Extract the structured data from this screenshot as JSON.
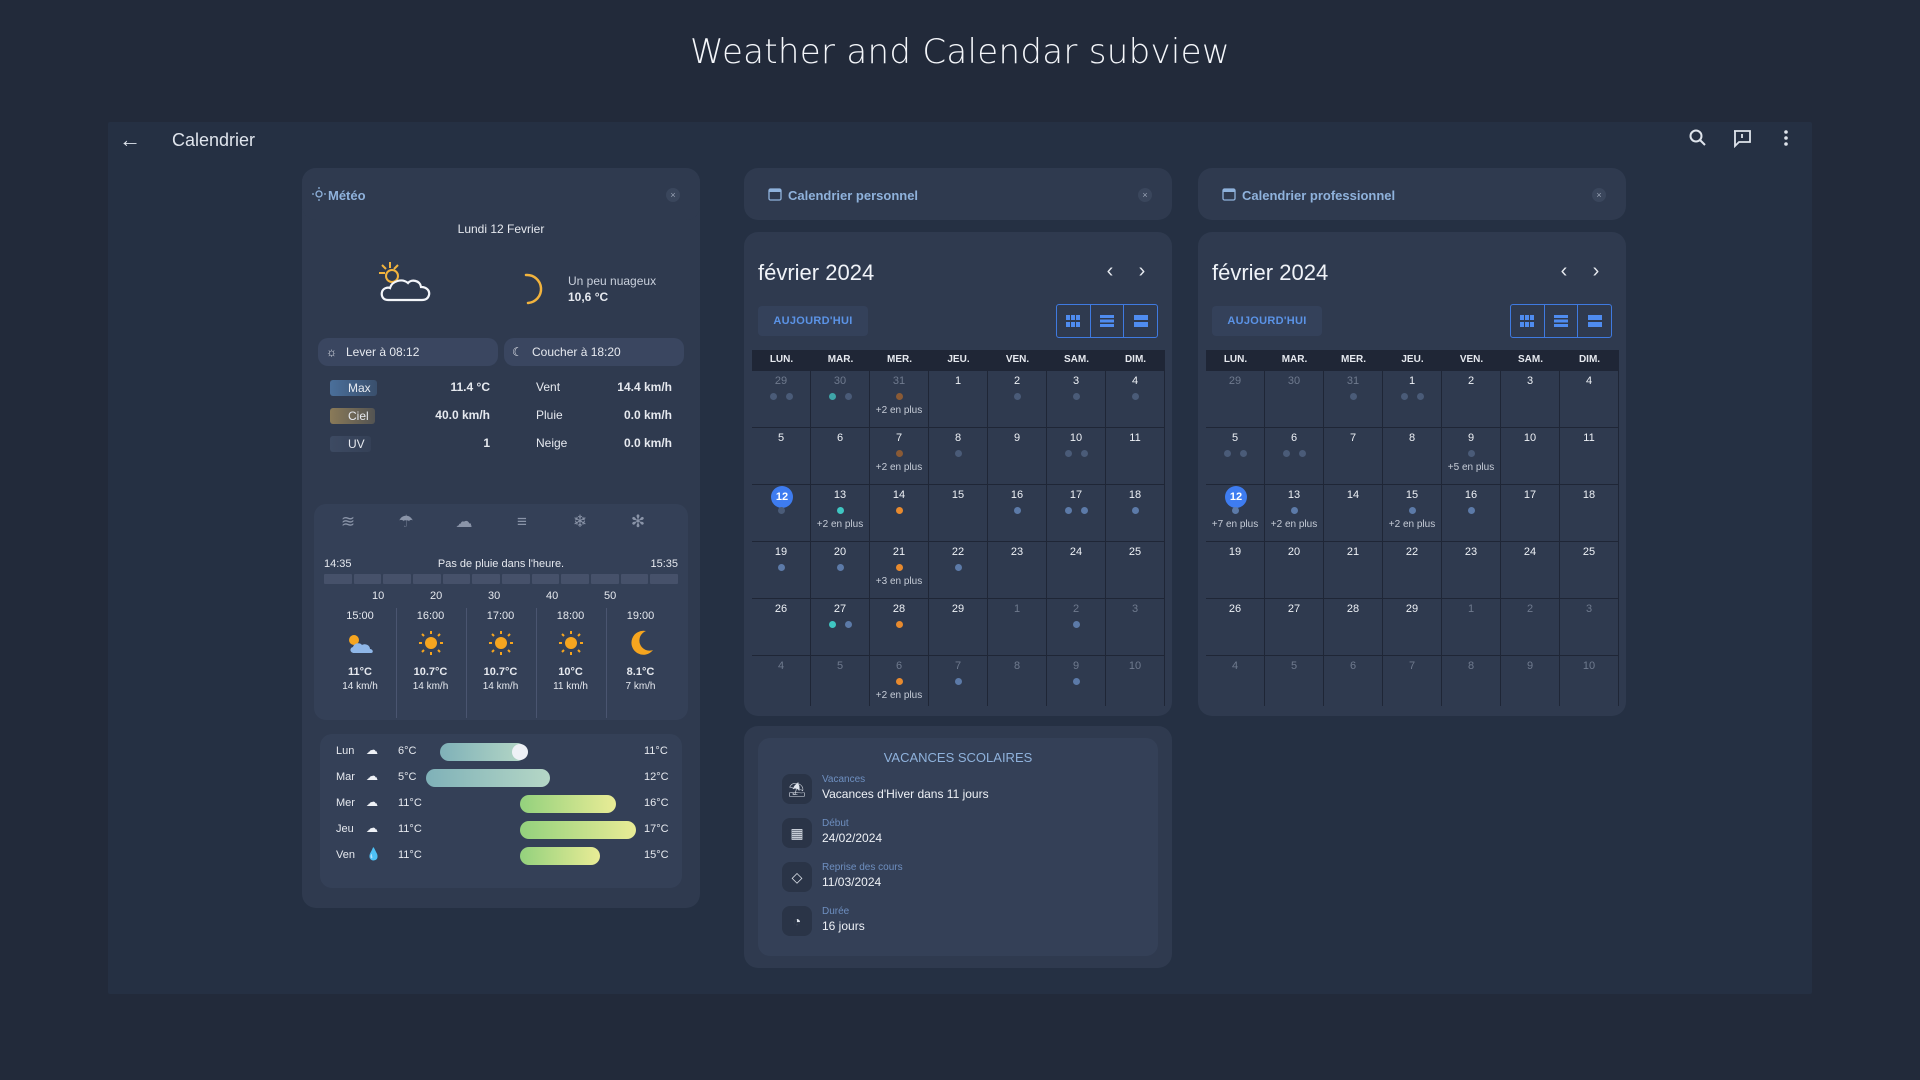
{
  "slide_title": "Weather and Calendar subview",
  "app": {
    "title": "Calendrier"
  },
  "weather": {
    "title": "Météo",
    "date": "Lundi 12 Fevrier",
    "condition": "Un peu nuageux",
    "temp": "10,6 °C",
    "sunrise": "Lever à 08:12",
    "sunset": "Coucher à 18:20",
    "stats": [
      {
        "label": "Max",
        "value": "11.4 °C",
        "label2": "Vent",
        "value2": "14.4 km/h"
      },
      {
        "label": "Ciel",
        "value": "40.0 km/h",
        "label2": "Pluie",
        "value2": "0.0 km/h"
      },
      {
        "label": "UV",
        "value": "1",
        "label2": "Neige",
        "value2": "0.0 km/h"
      }
    ],
    "rain": {
      "start": "14:35",
      "end": "15:35",
      "message": "Pas de pluie dans l'heure.",
      "ticks": [
        "10",
        "20",
        "30",
        "40",
        "50"
      ]
    },
    "hourly": [
      {
        "time": "15:00",
        "icon": "sun-cloud-icon",
        "temp": "11°C",
        "wind": "14 km/h"
      },
      {
        "time": "16:00",
        "icon": "sun-icon",
        "temp": "10.7°C",
        "wind": "14 km/h"
      },
      {
        "time": "17:00",
        "icon": "sun-icon",
        "temp": "10.7°C",
        "wind": "14 km/h"
      },
      {
        "time": "18:00",
        "icon": "sun-icon",
        "temp": "10°C",
        "wind": "11 km/h"
      },
      {
        "time": "19:00",
        "icon": "moon-icon",
        "temp": "8.1°C",
        "wind": "7 km/h"
      }
    ],
    "forecast": [
      {
        "day": "Lun",
        "min": "6°C",
        "max": "11°C",
        "icon": "cloud-icon"
      },
      {
        "day": "Mar",
        "min": "5°C",
        "max": "12°C",
        "icon": "cloud-icon"
      },
      {
        "day": "Mer",
        "min": "11°C",
        "max": "16°C",
        "icon": "cloud-icon"
      },
      {
        "day": "Jeu",
        "min": "11°C",
        "max": "17°C",
        "icon": "cloud-icon"
      },
      {
        "day": "Ven",
        "min": "11°C",
        "max": "15°C",
        "icon": "drop-icon"
      }
    ]
  },
  "personal_cal": {
    "title": "Calendrier personnel",
    "month": "février 2024",
    "today_label": "AUJOURD'HUI",
    "dow": [
      "LUN.",
      "MAR.",
      "MER.",
      "JEU.",
      "VEN.",
      "SAM.",
      "DIM."
    ],
    "weeks": [
      [
        {
          "n": "29",
          "dim": true,
          "dots": [
            "#4a5b78",
            "#4a5b78"
          ]
        },
        {
          "n": "30",
          "dim": true,
          "dots": [
            "#3fa5a8",
            "#4a5b78"
          ]
        },
        {
          "n": "31",
          "dim": true,
          "dots": [
            "#8a5a35"
          ],
          "more": "+2 en plus"
        },
        {
          "n": "1"
        },
        {
          "n": "2",
          "dots": [
            "#4a5b78"
          ]
        },
        {
          "n": "3",
          "dots": [
            "#4a5b78"
          ]
        },
        {
          "n": "4",
          "dots": [
            "#4a5b78"
          ]
        }
      ],
      [
        {
          "n": "5"
        },
        {
          "n": "6"
        },
        {
          "n": "7",
          "dots": [
            "#8a5a35"
          ],
          "more": "+2 en plus"
        },
        {
          "n": "8",
          "dots": [
            "#4a5b78"
          ]
        },
        {
          "n": "9"
        },
        {
          "n": "10",
          "dots": [
            "#4a5b78",
            "#4a5b78"
          ]
        },
        {
          "n": "11"
        }
      ],
      [
        {
          "n": "12",
          "today": true,
          "dots": [
            "#4a5b78"
          ]
        },
        {
          "n": "13",
          "dots": [
            "#3fc6c2"
          ],
          "more": "+2 en plus"
        },
        {
          "n": "14",
          "dots": [
            "#e88a2e"
          ]
        },
        {
          "n": "15"
        },
        {
          "n": "16",
          "dots": [
            "#5c7aa8"
          ]
        },
        {
          "n": "17",
          "dots": [
            "#5c7aa8",
            "#5c7aa8"
          ]
        },
        {
          "n": "18",
          "dots": [
            "#5c7aa8"
          ]
        }
      ],
      [
        {
          "n": "19",
          "dots": [
            "#5c7aa8"
          ]
        },
        {
          "n": "20",
          "dots": [
            "#5c7aa8"
          ]
        },
        {
          "n": "21",
          "dots": [
            "#e88a2e"
          ],
          "more": "+3 en plus"
        },
        {
          "n": "22",
          "dots": [
            "#5c7aa8"
          ]
        },
        {
          "n": "23"
        },
        {
          "n": "24"
        },
        {
          "n": "25"
        }
      ],
      [
        {
          "n": "26"
        },
        {
          "n": "27",
          "dots": [
            "#3fc6c2",
            "#5c7aa8"
          ]
        },
        {
          "n": "28",
          "dots": [
            "#e88a2e"
          ]
        },
        {
          "n": "29"
        },
        {
          "n": "1",
          "dim": true
        },
        {
          "n": "2",
          "dim": true,
          "dots": [
            "#5c7aa8"
          ]
        },
        {
          "n": "3",
          "dim": true
        }
      ],
      [
        {
          "n": "4",
          "dim": true
        },
        {
          "n": "5",
          "dim": true
        },
        {
          "n": "6",
          "dim": true,
          "dots": [
            "#e88a2e"
          ],
          "more": "+2 en plus"
        },
        {
          "n": "7",
          "dim": true,
          "dots": [
            "#5c7aa8"
          ]
        },
        {
          "n": "8",
          "dim": true
        },
        {
          "n": "9",
          "dim": true,
          "dots": [
            "#5c7aa8"
          ]
        },
        {
          "n": "10",
          "dim": true
        }
      ]
    ]
  },
  "pro_cal": {
    "title": "Calendrier professionnel",
    "month": "février 2024",
    "today_label": "AUJOURD'HUI",
    "dow": [
      "LUN.",
      "MAR.",
      "MER.",
      "JEU.",
      "VEN.",
      "SAM.",
      "DIM."
    ],
    "weeks": [
      [
        {
          "n": "29",
          "dim": true
        },
        {
          "n": "30",
          "dim": true
        },
        {
          "n": "31",
          "dim": true,
          "dots": [
            "#4a5b78"
          ]
        },
        {
          "n": "1",
          "dots": [
            "#4a5b78",
            "#4a5b78"
          ]
        },
        {
          "n": "2"
        },
        {
          "n": "3"
        },
        {
          "n": "4"
        }
      ],
      [
        {
          "n": "5",
          "dots": [
            "#4a5b78",
            "#4a5b78"
          ]
        },
        {
          "n": "6",
          "dots": [
            "#4a5b78",
            "#4a5b78"
          ]
        },
        {
          "n": "7"
        },
        {
          "n": "8"
        },
        {
          "n": "9",
          "dots": [
            "#4a5b78"
          ],
          "more": "+5 en plus"
        },
        {
          "n": "10"
        },
        {
          "n": "11"
        }
      ],
      [
        {
          "n": "12",
          "today": true,
          "dots": [
            "#5c7aa8"
          ],
          "more": "+7 en plus"
        },
        {
          "n": "13",
          "dots": [
            "#5c7aa8"
          ],
          "more": "+2 en plus"
        },
        {
          "n": "14"
        },
        {
          "n": "15",
          "dots": [
            "#5c7aa8"
          ],
          "more": "+2 en plus"
        },
        {
          "n": "16",
          "dots": [
            "#5c7aa8"
          ]
        },
        {
          "n": "17"
        },
        {
          "n": "18"
        }
      ],
      [
        {
          "n": "19"
        },
        {
          "n": "20"
        },
        {
          "n": "21"
        },
        {
          "n": "22"
        },
        {
          "n": "23"
        },
        {
          "n": "24"
        },
        {
          "n": "25"
        }
      ],
      [
        {
          "n": "26"
        },
        {
          "n": "27"
        },
        {
          "n": "28"
        },
        {
          "n": "29"
        },
        {
          "n": "1",
          "dim": true
        },
        {
          "n": "2",
          "dim": true
        },
        {
          "n": "3",
          "dim": true
        }
      ],
      [
        {
          "n": "4",
          "dim": true
        },
        {
          "n": "5",
          "dim": true
        },
        {
          "n": "6",
          "dim": true
        },
        {
          "n": "7",
          "dim": true
        },
        {
          "n": "8",
          "dim": true
        },
        {
          "n": "9",
          "dim": true
        },
        {
          "n": "10",
          "dim": true
        }
      ]
    ]
  },
  "vacances": {
    "title": "VACANCES SCOLAIRES",
    "rows": [
      {
        "icon": "beach-icon",
        "label": "Vacances",
        "value": "Vacances d'Hiver dans 11 jours"
      },
      {
        "icon": "calendar-icon",
        "label": "Début",
        "value": "24/02/2024"
      },
      {
        "icon": "graduation-icon",
        "label": "Reprise des cours",
        "value": "11/03/2024"
      },
      {
        "icon": "timer-icon",
        "label": "Durée",
        "value": "16 jours"
      }
    ]
  }
}
